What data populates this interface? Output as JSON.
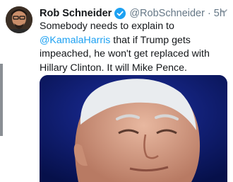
{
  "tweet": {
    "author_name": "Rob Schneider",
    "handle": "@RobSchneider",
    "separator": "·",
    "time": "5h",
    "text_before_mention": "Somebody needs to explain to ",
    "mention": "@KamalaHarris",
    "text_after_mention": " that if Trump gets impeached, he won't get replaced with Hillary Clinton. It will Mike Pence."
  },
  "icons": {
    "verified": "verified-badge-icon",
    "menu": "chevron-down-icon"
  },
  "colors": {
    "link": "#1da1f2",
    "secondary_text": "#657786",
    "verified": "#1da1f2"
  }
}
